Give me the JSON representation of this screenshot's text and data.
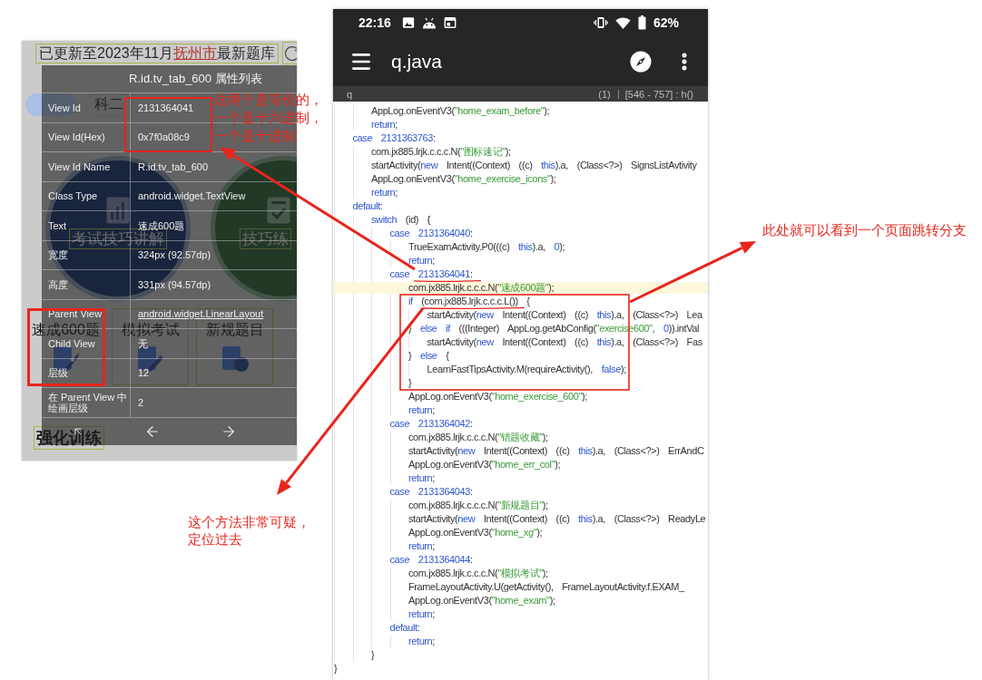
{
  "left_screenshot": {
    "update_notice": {
      "text_before": "已更新至2023年11月",
      "city": "抚州市",
      "text_after": "最新题库"
    },
    "tabs": [
      {
        "selected": true
      },
      {
        "label": "科二",
        "selected": false
      }
    ],
    "feature_circles": [
      {
        "label": "考试技巧讲解",
        "kind": "video"
      },
      {
        "label": "技巧练",
        "kind": "practice"
      }
    ],
    "grid_items": [
      {
        "label": "速成600题",
        "kind": "rocket",
        "inspected": true
      },
      {
        "label": "模拟考试",
        "kind": "pencil",
        "inspected": false
      },
      {
        "label": "新规题目",
        "kind": "badge",
        "inspected": false
      }
    ],
    "section_title": "强化训练",
    "inspector": {
      "title": "R.id.tv_tab_600 属性列表",
      "rows": [
        {
          "label": "View Id",
          "value": "2131364041",
          "kind": "text"
        },
        {
          "label": "View Id(Hex)",
          "value": "0x7f0a08c9",
          "kind": "text"
        },
        {
          "label": "View Id Name",
          "value": "R.id.tv_tab_600",
          "kind": "text"
        },
        {
          "label": "Class Type",
          "value": "android.widget.TextView",
          "kind": "text"
        },
        {
          "label": "Text",
          "value": "速成600题",
          "kind": "text"
        },
        {
          "label": "宽度",
          "value": "324px (92.57dp)",
          "kind": "text"
        },
        {
          "label": "高度",
          "value": "331px (94.57dp)",
          "kind": "text"
        },
        {
          "label": "Parent View",
          "value": "android.widget.LinearLayout",
          "kind": "link"
        },
        {
          "label": "Child View",
          "value": "无",
          "kind": "text"
        },
        {
          "label": "层级",
          "value": "12",
          "kind": "text"
        },
        {
          "label": "在 Parent View 中绘画层级",
          "value": "2",
          "kind": "text"
        }
      ]
    }
  },
  "equivalence_note": "这两个是等价的，一个是十六进制，一个是十进制",
  "code_viewer": {
    "status_bar": {
      "time": "22:16",
      "battery": "62%"
    },
    "title": "q.java",
    "search": {
      "query": "q",
      "match_count": "(1)",
      "range": "[546 - 757] : h()"
    },
    "code": {
      "lines": [
        {
          "children": [
            {
              "children": [
                {
                  "tokens": [
                    {
                      "kind": "plain",
                      "text": "AppLog.onEventV3("
                    },
                    {
                      "kind": "string",
                      "text": "\"home_exam_before\""
                    },
                    {
                      "kind": "plain",
                      "text": ");"
                    }
                  ],
                  "highlighted": false
                },
                {
                  "tokens": [
                    {
                      "kind": "keyword",
                      "text": "return"
                    },
                    {
                      "kind": "plain",
                      "text": ";"
                    }
                  ],
                  "highlighted": false
                }
              ]
            },
            {
              "tokens": [
                {
                  "kind": "keyword",
                  "text": "case "
                },
                {
                  "kind": "number",
                  "text": "2131363763"
                },
                {
                  "kind": "plain",
                  "text": ":"
                }
              ],
              "highlighted": false,
              "children": [
                {
                  "tokens": [
                    {
                      "kind": "plain",
                      "text": "com.jx885.lrjk.c.c.c.N("
                    },
                    {
                      "kind": "string",
                      "text": "\"图标速记\""
                    },
                    {
                      "kind": "plain",
                      "text": ");"
                    }
                  ],
                  "highlighted": false
                },
                {
                  "tokens": [
                    {
                      "kind": "plain",
                      "text": "startActivity("
                    },
                    {
                      "kind": "keyword",
                      "text": "new"
                    },
                    {
                      "kind": "plain",
                      "text": " Intent((Context) ((c) "
                    },
                    {
                      "kind": "keyword",
                      "text": "this"
                    },
                    {
                      "kind": "plain",
                      "text": ").a, (Class<?>) SignsListAvtivity"
                    }
                  ],
                  "highlighted": false
                },
                {
                  "tokens": [
                    {
                      "kind": "plain",
                      "text": "AppLog.onEventV3("
                    },
                    {
                      "kind": "string",
                      "text": "\"home_exercise_icons\""
                    },
                    {
                      "kind": "plain",
                      "text": ");"
                    }
                  ],
                  "highlighted": false
                },
                {
                  "tokens": [
                    {
                      "kind": "keyword",
                      "text": "return"
                    },
                    {
                      "kind": "plain",
                      "text": ";"
                    }
                  ],
                  "highlighted": false
                }
              ]
            },
            {
              "tokens": [
                {
                  "kind": "keyword",
                  "text": "default"
                },
                {
                  "kind": "plain",
                  "text": ":"
                }
              ],
              "highlighted": false,
              "children": [
                {
                  "tokens": [
                    {
                      "kind": "keyword",
                      "text": "switch"
                    },
                    {
                      "kind": "plain",
                      "text": " (id) {"
                    }
                  ],
                  "highlighted": false,
                  "children": [
                    {
                      "tokens": [
                        {
                          "kind": "keyword",
                          "text": "case "
                        },
                        {
                          "kind": "number",
                          "text": "2131364040"
                        },
                        {
                          "kind": "plain",
                          "text": ":"
                        }
                      ],
                      "highlighted": false,
                      "children": [
                        {
                          "tokens": [
                            {
                              "kind": "plain",
                              "text": "TrueExamActivity.P0(((c) "
                            },
                            {
                              "kind": "keyword",
                              "text": "this"
                            },
                            {
                              "kind": "plain",
                              "text": ").a, "
                            },
                            {
                              "kind": "number",
                              "text": "0"
                            },
                            {
                              "kind": "plain",
                              "text": ");"
                            }
                          ],
                          "highlighted": false
                        },
                        {
                          "tokens": [
                            {
                              "kind": "keyword",
                              "text": "return"
                            },
                            {
                              "kind": "plain",
                              "text": ";"
                            }
                          ],
                          "highlighted": false
                        }
                      ]
                    },
                    {
                      "tokens": [
                        {
                          "kind": "keyword",
                          "text": "case "
                        },
                        {
                          "kind": "number",
                          "text": "2131364041"
                        },
                        {
                          "kind": "plain",
                          "text": ":"
                        }
                      ],
                      "highlighted": false,
                      "children": [
                        {
                          "tokens": [
                            {
                              "kind": "plain",
                              "text": "com.jx885.lrjk.c.c.c.N("
                            },
                            {
                              "kind": "string",
                              "text": "\"速成600题\""
                            },
                            {
                              "kind": "plain",
                              "text": ");"
                            }
                          ],
                          "highlighted": true
                        },
                        {
                          "tokens": [
                            {
                              "kind": "keyword",
                              "text": "if"
                            },
                            {
                              "kind": "plain",
                              "text": " (com.jx885.lrjk.c.c.c.L()) {"
                            }
                          ],
                          "highlighted": false,
                          "children": [
                            {
                              "tokens": [
                                {
                                  "kind": "plain",
                                  "text": "startActivity("
                                },
                                {
                                  "kind": "keyword",
                                  "text": "new"
                                },
                                {
                                  "kind": "plain",
                                  "text": " Intent((Context) ((c) "
                                },
                                {
                                  "kind": "keyword",
                                  "text": "this"
                                },
                                {
                                  "kind": "plain",
                                  "text": ").a, (Class<?>) Lea"
                                }
                              ],
                              "highlighted": false
                            }
                          ]
                        },
                        {
                          "tokens": [
                            {
                              "kind": "plain",
                              "text": "} "
                            },
                            {
                              "kind": "keyword",
                              "text": "else if"
                            },
                            {
                              "kind": "plain",
                              "text": " (((Integer) AppLog.getAbConfig("
                            },
                            {
                              "kind": "string",
                              "text": "\"exercise600\""
                            },
                            {
                              "kind": "plain",
                              "text": ", "
                            },
                            {
                              "kind": "number",
                              "text": "0"
                            },
                            {
                              "kind": "plain",
                              "text": ")).intVal"
                            }
                          ],
                          "highlighted": false,
                          "children": [
                            {
                              "tokens": [
                                {
                                  "kind": "plain",
                                  "text": "startActivity("
                                },
                                {
                                  "kind": "keyword",
                                  "text": "new"
                                },
                                {
                                  "kind": "plain",
                                  "text": " Intent((Context) ((c) "
                                },
                                {
                                  "kind": "keyword",
                                  "text": "this"
                                },
                                {
                                  "kind": "plain",
                                  "text": ").a, (Class<?>) Fas"
                                }
                              ],
                              "highlighted": false
                            }
                          ]
                        },
                        {
                          "tokens": [
                            {
                              "kind": "plain",
                              "text": "} "
                            },
                            {
                              "kind": "keyword",
                              "text": "else"
                            },
                            {
                              "kind": "plain",
                              "text": " {"
                            }
                          ],
                          "highlighted": false,
                          "children": [
                            {
                              "tokens": [
                                {
                                  "kind": "plain",
                                  "text": "LearnFastTipsActivity.M(requireActivity(), "
                                },
                                {
                                  "kind": "keyword",
                                  "text": "false"
                                },
                                {
                                  "kind": "plain",
                                  "text": ");"
                                }
                              ],
                              "highlighted": false
                            }
                          ]
                        },
                        {
                          "tokens": [
                            {
                              "kind": "plain",
                              "text": "}"
                            }
                          ],
                          "highlighted": false
                        },
                        {
                          "tokens": [
                            {
                              "kind": "plain",
                              "text": "AppLog.onEventV3("
                            },
                            {
                              "kind": "string",
                              "text": "\"home_exercise_600\""
                            },
                            {
                              "kind": "plain",
                              "text": ");"
                            }
                          ],
                          "highlighted": false
                        },
                        {
                          "tokens": [
                            {
                              "kind": "keyword",
                              "text": "return"
                            },
                            {
                              "kind": "plain",
                              "text": ";"
                            }
                          ],
                          "highlighted": false
                        }
                      ]
                    },
                    {
                      "tokens": [
                        {
                          "kind": "keyword",
                          "text": "case "
                        },
                        {
                          "kind": "number",
                          "text": "2131364042"
                        },
                        {
                          "kind": "plain",
                          "text": ":"
                        }
                      ],
                      "highlighted": false,
                      "children": [
                        {
                          "tokens": [
                            {
                              "kind": "plain",
                              "text": "com.jx885.lrjk.c.c.c.N("
                            },
                            {
                              "kind": "string",
                              "text": "\"错题收藏\""
                            },
                            {
                              "kind": "plain",
                              "text": ");"
                            }
                          ],
                          "highlighted": false
                        },
                        {
                          "tokens": [
                            {
                              "kind": "plain",
                              "text": "startActivity("
                            },
                            {
                              "kind": "keyword",
                              "text": "new"
                            },
                            {
                              "kind": "plain",
                              "text": " Intent((Context) ((c) "
                            },
                            {
                              "kind": "keyword",
                              "text": "this"
                            },
                            {
                              "kind": "plain",
                              "text": ").a, (Class<?>) ErrAndC"
                            }
                          ],
                          "highlighted": false
                        },
                        {
                          "tokens": [
                            {
                              "kind": "plain",
                              "text": "AppLog.onEventV3("
                            },
                            {
                              "kind": "string",
                              "text": "\"home_err_col\""
                            },
                            {
                              "kind": "plain",
                              "text": ");"
                            }
                          ],
                          "highlighted": false
                        },
                        {
                          "tokens": [
                            {
                              "kind": "keyword",
                              "text": "return"
                            },
                            {
                              "kind": "plain",
                              "text": ";"
                            }
                          ],
                          "highlighted": false
                        }
                      ]
                    },
                    {
                      "tokens": [
                        {
                          "kind": "keyword",
                          "text": "case "
                        },
                        {
                          "kind": "number",
                          "text": "2131364043"
                        },
                        {
                          "kind": "plain",
                          "text": ":"
                        }
                      ],
                      "highlighted": false,
                      "children": [
                        {
                          "tokens": [
                            {
                              "kind": "plain",
                              "text": "com.jx885.lrjk.c.c.c.N("
                            },
                            {
                              "kind": "string",
                              "text": "\"新规题目\""
                            },
                            {
                              "kind": "plain",
                              "text": ");"
                            }
                          ],
                          "highlighted": false
                        },
                        {
                          "tokens": [
                            {
                              "kind": "plain",
                              "text": "startActivity("
                            },
                            {
                              "kind": "keyword",
                              "text": "new"
                            },
                            {
                              "kind": "plain",
                              "text": " Intent((Context) ((c) "
                            },
                            {
                              "kind": "keyword",
                              "text": "this"
                            },
                            {
                              "kind": "plain",
                              "text": ").a, (Class<?>) ReadyLe"
                            }
                          ],
                          "highlighted": false
                        },
                        {
                          "tokens": [
                            {
                              "kind": "plain",
                              "text": "AppLog.onEventV3("
                            },
                            {
                              "kind": "string",
                              "text": "\"home_xg\""
                            },
                            {
                              "kind": "plain",
                              "text": ");"
                            }
                          ],
                          "highlighted": false
                        },
                        {
                          "tokens": [
                            {
                              "kind": "keyword",
                              "text": "return"
                            },
                            {
                              "kind": "plain",
                              "text": ";"
                            }
                          ],
                          "highlighted": false
                        }
                      ]
                    },
                    {
                      "tokens": [
                        {
                          "kind": "keyword",
                          "text": "case "
                        },
                        {
                          "kind": "number",
                          "text": "2131364044"
                        },
                        {
                          "kind": "plain",
                          "text": ":"
                        }
                      ],
                      "highlighted": false,
                      "children": [
                        {
                          "tokens": [
                            {
                              "kind": "plain",
                              "text": "com.jx885.lrjk.c.c.c.N("
                            },
                            {
                              "kind": "string",
                              "text": "\"模拟考试\""
                            },
                            {
                              "kind": "plain",
                              "text": ");"
                            }
                          ],
                          "highlighted": false
                        },
                        {
                          "tokens": [
                            {
                              "kind": "plain",
                              "text": "FrameLayoutActivity.U(getActivity(), FrameLayoutActivity.f.EXAM_"
                            }
                          ],
                          "highlighted": false
                        },
                        {
                          "tokens": [
                            {
                              "kind": "plain",
                              "text": "AppLog.onEventV3("
                            },
                            {
                              "kind": "string",
                              "text": "\"home_exam\""
                            },
                            {
                              "kind": "plain",
                              "text": ");"
                            }
                          ],
                          "highlighted": false
                        },
                        {
                          "tokens": [
                            {
                              "kind": "keyword",
                              "text": "return"
                            },
                            {
                              "kind": "plain",
                              "text": ";"
                            }
                          ],
                          "highlighted": false
                        }
                      ]
                    },
                    {
                      "tokens": [
                        {
                          "kind": "keyword",
                          "text": "default"
                        },
                        {
                          "kind": "plain",
                          "text": ":"
                        }
                      ],
                      "highlighted": false,
                      "children": [
                        {
                          "tokens": [
                            {
                              "kind": "keyword",
                              "text": "return"
                            },
                            {
                              "kind": "plain",
                              "text": ";"
                            }
                          ],
                          "highlighted": false
                        }
                      ]
                    }
                  ]
                },
                {
                  "tokens": [
                    {
                      "kind": "plain",
                      "text": "}"
                    }
                  ],
                  "highlighted": false
                }
              ]
            }
          ]
        },
        {
          "tokens": [
            {
              "kind": "plain",
              "text": "}"
            }
          ],
          "highlighted": false
        }
      ]
    }
  },
  "suspicious_note": "这个方法非常可疑，定位过去",
  "branch_note": "此处就可以看到一个页面跳转分支"
}
